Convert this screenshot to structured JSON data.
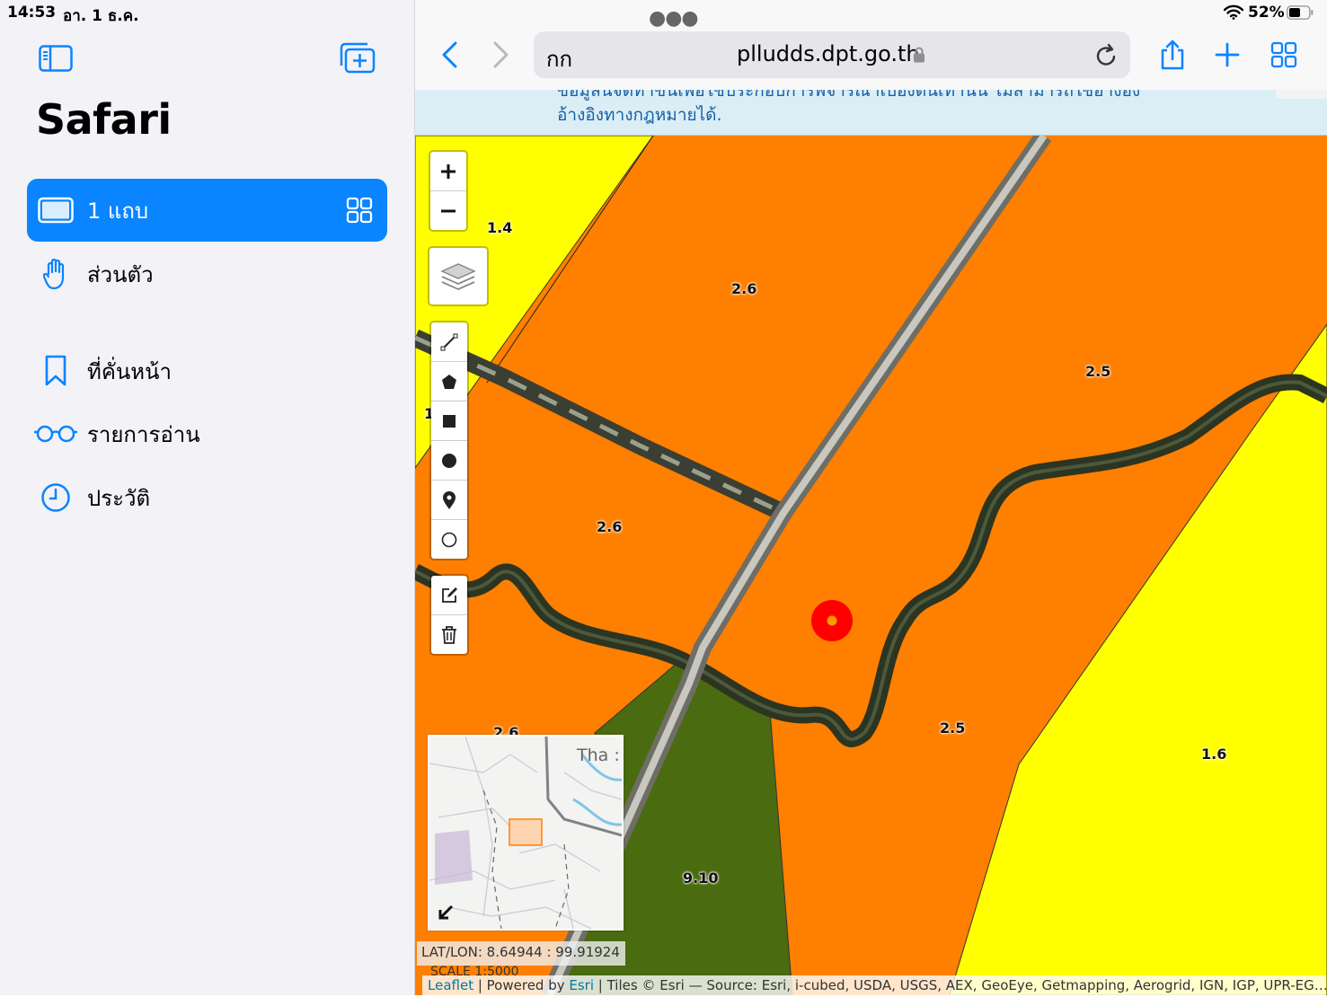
{
  "status_bar": {
    "time": "14:53",
    "date": "อา. 1 ธ.ค.",
    "battery": "52%"
  },
  "sidebar": {
    "title": "Safari",
    "items": [
      {
        "label": "1 แถบ",
        "icon": "ipad-icon",
        "selected": true
      },
      {
        "label": "ส่วนตัว",
        "icon": "hand-icon"
      },
      {
        "label": "ที่คั่นหน้า",
        "icon": "bookmark-icon"
      },
      {
        "label": "รายการอ่าน",
        "icon": "glasses-icon"
      },
      {
        "label": "ประวัติ",
        "icon": "clock-icon"
      }
    ]
  },
  "toolbar": {
    "reader_label": "กก",
    "url": "plludds.dpt.go.th"
  },
  "banner": {
    "line1": "ข้อมูลนี้จัดทำขึ้นเพื่อใช้ประกอบการพิจารณาเบื้องต้นเท่านั้น ไม่สามารถใช้อ้างอิง",
    "line2": "อ้างอิงทางกฎหมายได้."
  },
  "map": {
    "zone_labels": [
      "1.4",
      "2.6",
      "2.5",
      "2.6",
      "1",
      "2.6",
      "2.5",
      "1.6",
      "9.10"
    ],
    "zone_colors": {
      "agricultural": "#ff7f00",
      "rural": "#ffff00",
      "forest": "#4a6b0f"
    },
    "marker_color": "#ff0000",
    "minimap_label": "Tha :",
    "latlon": "LAT/LON: 8.64944 : 99.91924",
    "scale": "SCALE 1:5000",
    "attribution": {
      "leaflet": "Leaflet",
      "powered": " | Powered by ",
      "esri": "Esri",
      "rest": " | Tiles © Esri — Source: Esri, i-cubed, USDA, USGS, AEX, GeoEye, Getmapping, Aerogrid, IGN, IGP, UPR-EG…"
    }
  }
}
